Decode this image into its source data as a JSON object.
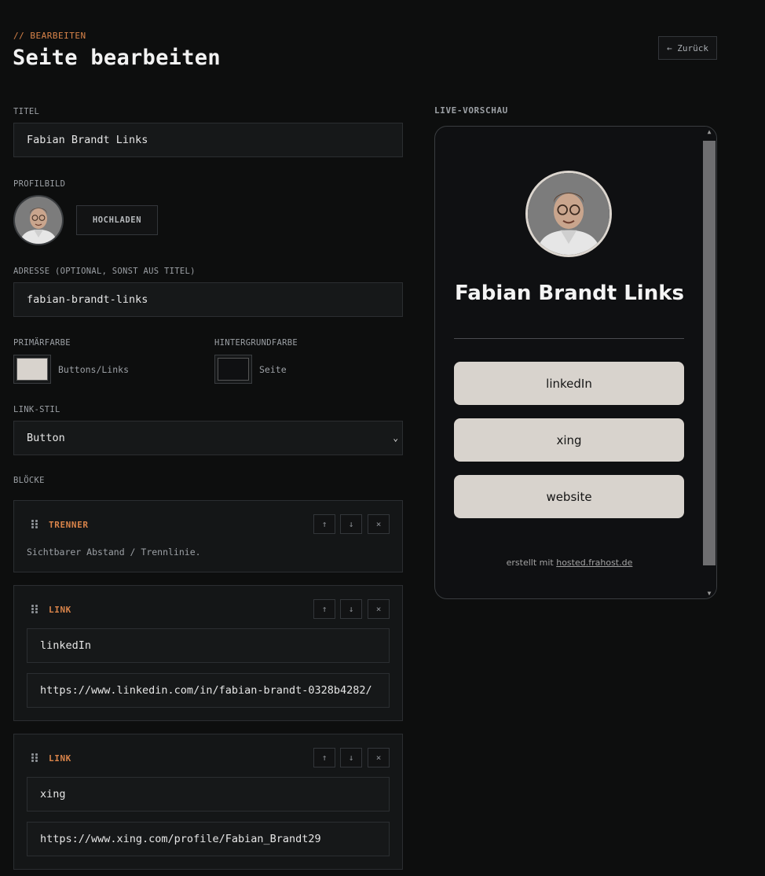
{
  "header": {
    "eyebrow": "// BEARBEITEN",
    "title": "Seite bearbeiten",
    "back_label": "← Zurück"
  },
  "form": {
    "title_label": "TITEL",
    "title_value": "Fabian Brandt Links",
    "profile_label": "PROFILBILD",
    "upload_label": "HOCHLADEN",
    "address_label": "ADRESSE (OPTIONAL, SONST AUS TITEL)",
    "address_value": "fabian-brandt-links",
    "primary_color_label": "PRIMÄRFARBE",
    "primary_color_caption": "Buttons/Links",
    "primary_color": "#d8d3cd",
    "background_color_label": "HINTERGRUNDFARBE",
    "background_color_caption": "Seite",
    "background_color": "#0f1012",
    "link_style_label": "LINK-STIL",
    "link_style_value": "Button",
    "blocks_label": "BLÖCKE"
  },
  "blocks": [
    {
      "type": "TRENNER",
      "description": "Sichtbarer Abstand / Trennlinie."
    },
    {
      "type": "LINK",
      "label": "linkedIn",
      "url": "https://www.linkedin.com/in/fabian-brandt-0328b4282/"
    },
    {
      "type": "LINK",
      "label": "xing",
      "url": "https://www.xing.com/profile/Fabian_Brandt29"
    }
  ],
  "controls": {
    "up": "↑",
    "down": "↓",
    "remove": "×"
  },
  "preview": {
    "label": "LIVE-VORSCHAU",
    "title": "Fabian Brandt Links",
    "buttons": [
      "linkedIn",
      "xing",
      "website"
    ],
    "footer_prefix": "erstellt mit",
    "footer_link": "hosted.frahost.de"
  },
  "colors": {
    "accent": "#d9844a"
  }
}
